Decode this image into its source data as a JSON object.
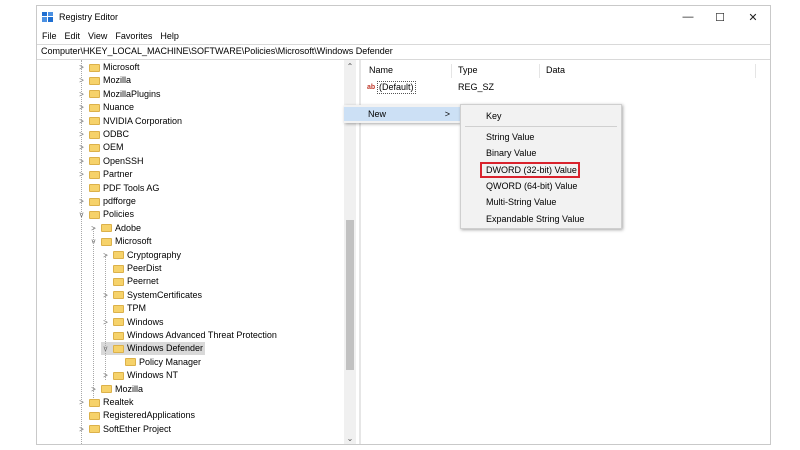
{
  "window": {
    "title": "Registry Editor",
    "controls": {
      "minimize": "—",
      "maximize": "☐",
      "close": "✕"
    }
  },
  "menu": [
    "File",
    "Edit",
    "View",
    "Favorites",
    "Help"
  ],
  "address": "Computer\\HKEY_LOCAL_MACHINE\\SOFTWARE\\Policies\\Microsoft\\Windows Defender",
  "tree": [
    {
      "label": "Microsoft",
      "chev": ">"
    },
    {
      "label": "Mozilla",
      "chev": ">"
    },
    {
      "label": "MozillaPlugins",
      "chev": ">"
    },
    {
      "label": "Nuance",
      "chev": ">"
    },
    {
      "label": "NVIDIA Corporation",
      "chev": ">"
    },
    {
      "label": "ODBC",
      "chev": ">"
    },
    {
      "label": "OEM",
      "chev": ">"
    },
    {
      "label": "OpenSSH",
      "chev": ">"
    },
    {
      "label": "Partner",
      "chev": ">"
    },
    {
      "label": "PDF Tools AG",
      "chev": ""
    },
    {
      "label": "pdfforge",
      "chev": ">"
    },
    {
      "label": "Policies",
      "chev": "v"
    },
    {
      "label": "Adobe",
      "chev": ">"
    },
    {
      "label": "Microsoft",
      "chev": "v"
    },
    {
      "label": "Cryptography",
      "chev": ">"
    },
    {
      "label": "PeerDist",
      "chev": ""
    },
    {
      "label": "Peernet",
      "chev": ""
    },
    {
      "label": "SystemCertificates",
      "chev": ">"
    },
    {
      "label": "TPM",
      "chev": ""
    },
    {
      "label": "Windows",
      "chev": ">"
    },
    {
      "label": "Windows Advanced Threat Protection",
      "chev": ""
    },
    {
      "label": "Windows Defender",
      "chev": "v"
    },
    {
      "label": "Policy Manager",
      "chev": ""
    },
    {
      "label": "Windows NT",
      "chev": ">"
    },
    {
      "label": "Mozilla",
      "chev": ">"
    },
    {
      "label": "Realtek",
      "chev": ">"
    },
    {
      "label": "RegisteredApplications",
      "chev": ""
    },
    {
      "label": "SoftEther Project",
      "chev": ">"
    }
  ],
  "list": {
    "columns": {
      "name": "Name",
      "type": "Type",
      "data": "Data"
    },
    "rows": [
      {
        "icon": "ab",
        "name": "(Default)",
        "type": "REG_SZ",
        "data": ""
      }
    ]
  },
  "context_menu": {
    "new_label": "New",
    "new_arrow": ">",
    "submenu": {
      "key": "Key",
      "string": "String Value",
      "binary": "Binary Value",
      "dword": "DWORD (32-bit) Value",
      "qword": "QWORD (64-bit) Value",
      "multi": "Multi-String Value",
      "expandable": "Expandable String Value"
    }
  },
  "colors": {
    "highlight_border": "#d9232d",
    "menu_hover": "#cce0f5",
    "folder": "#f6d26a"
  }
}
